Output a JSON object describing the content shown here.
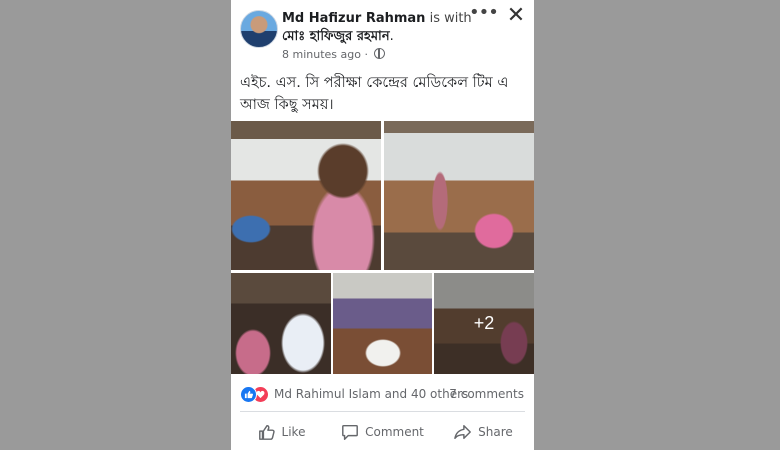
{
  "post": {
    "author": "Md Hafizur Rahman",
    "with_text": "is with",
    "tagged": "মোঃ হাফিজুর রহমান",
    "tagged_suffix": ".",
    "time": "8 minutes ago",
    "caption": "এইচ. এস. সি পরীক্ষা কেন্দ্রের মেডিকেল টিম এ আজ কিছু সময়।",
    "more_photos": "+2"
  },
  "icons": {
    "more": "more-options-icon",
    "close": "close-icon",
    "privacy": "globe-icon",
    "like": "like-icon",
    "comment": "comment-icon",
    "share": "share-icon"
  },
  "reactions": {
    "text": "Md Rahimul Islam and 40 others",
    "comments": "7 comments"
  },
  "actions": {
    "like": "Like",
    "comment": "Comment",
    "share": "Share"
  },
  "colors": {
    "backdrop": "#9a9a9a",
    "like_blue": "#1877f2",
    "love_red": "#f33e58"
  }
}
